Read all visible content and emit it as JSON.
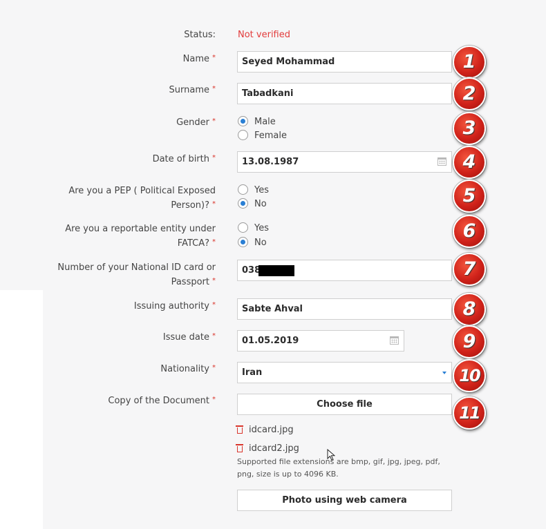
{
  "status": {
    "label": "Status:",
    "value": "Not verified"
  },
  "fields": {
    "name": {
      "label": "Name",
      "value": "Seyed Mohammad"
    },
    "surname": {
      "label": "Surname",
      "value": "Tabadkani"
    },
    "gender": {
      "label": "Gender",
      "options": [
        "Male",
        "Female"
      ],
      "selected": "Male"
    },
    "dob": {
      "label": "Date of birth",
      "value": "13.08.1987"
    },
    "pep": {
      "label_line1": "Are you a PEP ( Political Exposed",
      "label_line2": "Person)?",
      "options": [
        "Yes",
        "No"
      ],
      "selected": "No"
    },
    "fatca": {
      "label_line1": "Are you a reportable entity under",
      "label_line2": "FATCA?",
      "options": [
        "Yes",
        "No"
      ],
      "selected": "No"
    },
    "id_number": {
      "label_line1": "Number of your National ID card or",
      "label_line2": "Passport",
      "value": "038"
    },
    "issuing_authority": {
      "label": "Issuing authority",
      "value": "Sabte Ahval"
    },
    "issue_date": {
      "label": "Issue date",
      "value": "01.05.2019"
    },
    "nationality": {
      "label": "Nationality",
      "value": "Iran"
    },
    "document": {
      "label": "Copy of the Document",
      "choose_label": "Choose file"
    }
  },
  "required_mark": "*",
  "files": [
    "idcard.jpg",
    "idcard2.jpg"
  ],
  "help_text": "Supported file extensions are bmp, gif, jpg, jpeg, pdf, png, size is up to 4096 KB.",
  "webcam_button": "Photo using web camera",
  "badges": [
    "1",
    "2",
    "3",
    "4",
    "5",
    "6",
    "7",
    "8",
    "9",
    "10",
    "11"
  ],
  "colors": {
    "accent": "#2a7fd4",
    "error": "#e23b3b",
    "badge": "#d0221a"
  }
}
